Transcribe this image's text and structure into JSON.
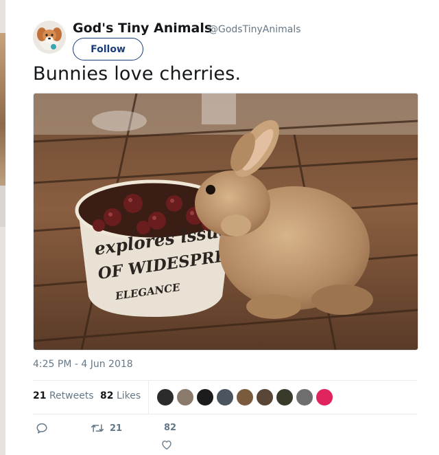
{
  "user": {
    "name": "God's Tiny Animals",
    "handle": "@GodsTinyAnimals",
    "avatar_icon": "puppy-avatar"
  },
  "follow_button": {
    "label": "Follow"
  },
  "tweet": {
    "text": "Bunnies love cherries."
  },
  "media": {
    "icon": "bunny-eating-cherries-photo",
    "bowl_text": [
      "explores issues",
      "OF WIDESPREAD",
      "ELEGANCE"
    ]
  },
  "timestamp": "4:25 PM - 4 Jun 2018",
  "stats": {
    "retweets_count": "21",
    "retweets_label": "Retweets",
    "likes_count": "82",
    "likes_label": "Likes"
  },
  "likers": [
    {
      "name": "liker-avatar-1",
      "color": "#2b2b2b"
    },
    {
      "name": "liker-avatar-2",
      "color": "#8a7a6b"
    },
    {
      "name": "liker-avatar-3",
      "color": "#1c1c1c"
    },
    {
      "name": "liker-avatar-4",
      "color": "#4a5560"
    },
    {
      "name": "liker-avatar-5",
      "color": "#7a5b3d"
    },
    {
      "name": "liker-avatar-6",
      "color": "#5a4636"
    },
    {
      "name": "liker-avatar-7",
      "color": "#3a3a2a"
    },
    {
      "name": "liker-avatar-8",
      "color": "#6e6e6e"
    },
    {
      "name": "liker-avatar-9",
      "color": "#e0245e"
    }
  ],
  "actions": {
    "reply_icon": "reply-icon",
    "retweet_icon": "retweet-icon",
    "retweet_count": "21",
    "like_icon": "heart-icon",
    "like_count": "82"
  },
  "colors": {
    "follow": "#1b3d7a",
    "muted": "#657786",
    "text": "#14171a",
    "border": "#e6ecf0"
  }
}
